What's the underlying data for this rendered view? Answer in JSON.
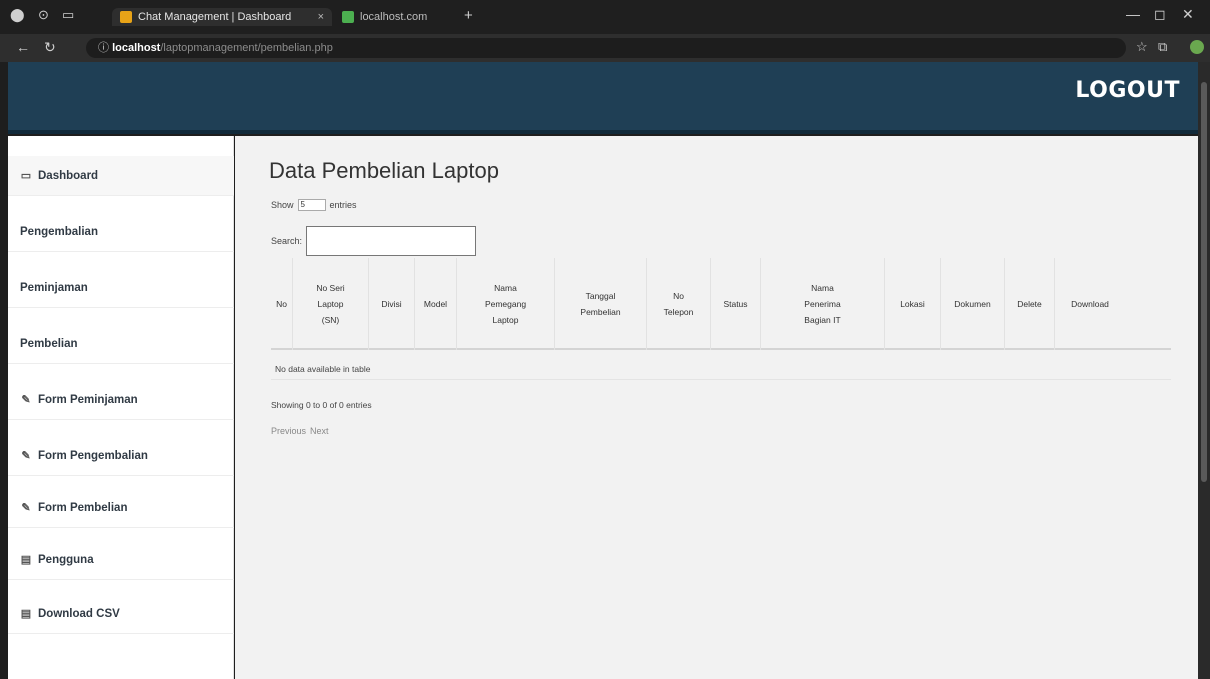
{
  "browser": {
    "tabs": [
      {
        "title": "Chat Management | Dashboard",
        "close": "×"
      },
      {
        "title": "localhost.com",
        "close": ""
      }
    ],
    "new_tab": "+",
    "url_host": "localhost",
    "url_path": "/laptopmanagement/pembelian.php",
    "window_controls": [
      "—",
      "◻",
      "✕"
    ]
  },
  "header": {
    "logout_label": "LOGOUT",
    "color": "#1f3f55"
  },
  "sidebar": {
    "items": [
      {
        "label": "Dashboard",
        "icon": "monitor-icon",
        "glyph": "▭"
      },
      {
        "label": "Pengembalian",
        "icon": "",
        "glyph": ""
      },
      {
        "label": "Peminjaman",
        "icon": "",
        "glyph": ""
      },
      {
        "label": "Pembelian",
        "icon": "",
        "glyph": ""
      },
      {
        "label": "Form Peminjaman",
        "icon": "edit-icon",
        "glyph": "✎"
      },
      {
        "label": "Form Pengembalian",
        "icon": "edit-icon",
        "glyph": "✎"
      },
      {
        "label": "Form Pembelian",
        "icon": "edit-icon",
        "glyph": "✎"
      },
      {
        "label": "Pengguna",
        "icon": "users-icon",
        "glyph": "▤"
      },
      {
        "label": "Download CSV",
        "icon": "download-icon",
        "glyph": "▤"
      }
    ]
  },
  "main": {
    "title": "Data Pembelian Laptop",
    "show_label": "Show",
    "show_value": "5",
    "entries_label": "entries",
    "search_label": "Search:",
    "search_value": "",
    "columns": [
      "No",
      "No Seri\nLaptop\n(SN)",
      "Divisi",
      "Model",
      "Nama\nPemegang\nLaptop",
      "Tanggal\nPembelian",
      "No\nTelepon",
      "Status",
      "Nama\nPenerima\nBagian IT",
      "Lokasi",
      "Dokumen",
      "Delete",
      "Download"
    ],
    "empty_text": "No data available in table",
    "info_text": "Showing 0 to 0 of 0 entries",
    "prev_label": "Previous",
    "next_label": "Next"
  }
}
